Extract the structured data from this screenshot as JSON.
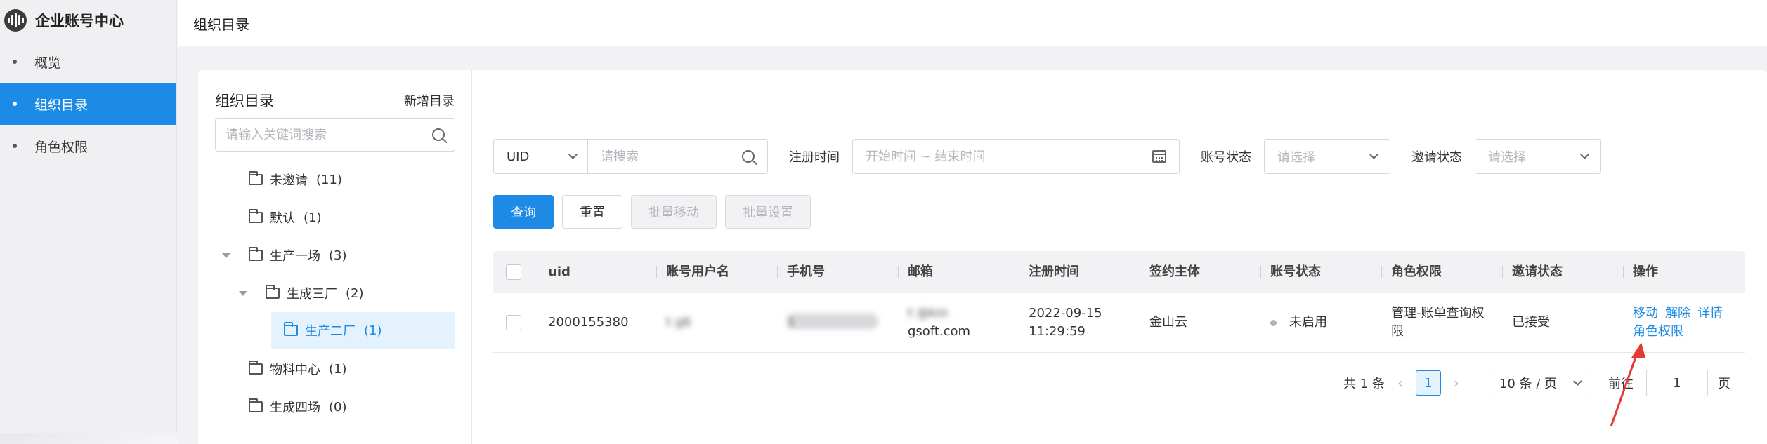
{
  "sidebar": {
    "brand": "企业账号中心",
    "items": [
      {
        "label": "概览"
      },
      {
        "label": "组织目录"
      },
      {
        "label": "角色权限"
      }
    ]
  },
  "header": {
    "title": "组织目录"
  },
  "tree": {
    "title": "组织目录",
    "add_label": "新增目录",
    "search_placeholder": "请输入关键词搜索",
    "nodes": [
      {
        "label": "未邀请",
        "count": "(11)"
      },
      {
        "label": "默认",
        "count": "(1)"
      },
      {
        "label": "生产一场",
        "count": "(3)"
      },
      {
        "label": "生成三厂",
        "count": "(2)"
      },
      {
        "label": "生产二厂",
        "count": "(1)"
      },
      {
        "label": "物料中心",
        "count": "(1)"
      },
      {
        "label": "生成四场",
        "count": "(0)"
      }
    ]
  },
  "filters": {
    "field_select": "UID",
    "search_placeholder": "请搜索",
    "reg_time_label": "注册时间",
    "date_placeholder": "开始时间 ~ 结束时间",
    "account_status_label": "账号状态",
    "account_status_placeholder": "请选择",
    "invite_status_label": "邀请状态",
    "invite_status_placeholder": "请选择"
  },
  "buttons": {
    "query": "查询",
    "reset": "重置",
    "batch_move": "批量移动",
    "batch_set": "批量设置"
  },
  "table": {
    "headers": [
      "uid",
      "账号用户名",
      "手机号",
      "邮箱",
      "注册时间",
      "签约主体",
      "账号状态",
      "角色权限",
      "邀请状态",
      "操作"
    ],
    "rows": [
      {
        "uid": "2000155380",
        "username": "t          g6",
        "phone": "1          ",
        "email_line1": "t          @kin",
        "email_line2": "gsoft.com",
        "reg_date": "2022-09-15",
        "reg_time": "11:29:59",
        "sign": "金山云",
        "status": "未启用",
        "role_line1": "管理-账单查询权",
        "role_line2": "限",
        "invite": "已接受",
        "ops": [
          "移动",
          "解除",
          "详情",
          "角色权限"
        ]
      }
    ]
  },
  "pagination": {
    "total": "共 1 条",
    "prev": "‹",
    "page": "1",
    "next": "›",
    "page_size": "10 条 / 页",
    "goto_label": "前往",
    "goto_value": "1",
    "unit": "页"
  },
  "colors": {
    "accent": "#1d8ae6",
    "annotation": "#e53935"
  }
}
